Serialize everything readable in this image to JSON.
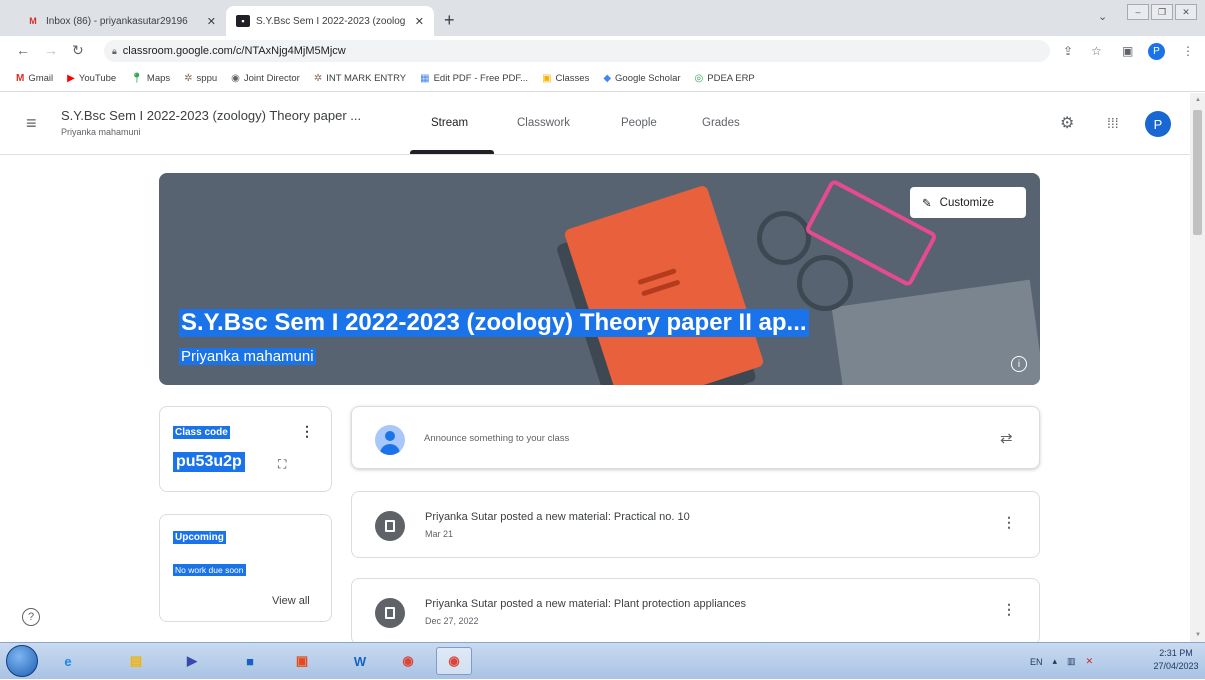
{
  "browser": {
    "tabs": [
      {
        "title": "Inbox (86) - priyankasutar29196",
        "favicon": "gmail-icon",
        "active": false
      },
      {
        "title": "S.Y.Bsc Sem I 2022-2023 (zoolog",
        "favicon": "classroom-icon",
        "active": true
      }
    ],
    "url": "classroom.google.com/c/NTAxNjg4MjM5Mjcw",
    "profile_initial": "P",
    "bookmarks": [
      {
        "label": "Gmail",
        "icon": "gmail-icon"
      },
      {
        "label": "YouTube",
        "icon": "youtube-icon"
      },
      {
        "label": "Maps",
        "icon": "maps-icon"
      },
      {
        "label": "sppu",
        "icon": "sppu-icon"
      },
      {
        "label": "Joint Director",
        "icon": "globe-icon"
      },
      {
        "label": "INT MARK ENTRY",
        "icon": "sppu-icon"
      },
      {
        "label": "Edit PDF - Free PDF...",
        "icon": "pdf-icon"
      },
      {
        "label": "Classes",
        "icon": "classroom-icon"
      },
      {
        "label": "Google Scholar",
        "icon": "scholar-icon"
      },
      {
        "label": "PDEA ERP",
        "icon": "erp-icon"
      }
    ]
  },
  "classroom": {
    "class_title": "S.Y.Bsc Sem I 2022-2023 (zoology) Theory paper ...",
    "class_teacher": "Priyanka mahamuni",
    "nav": [
      "Stream",
      "Classwork",
      "People",
      "Grades"
    ],
    "user_initial": "P",
    "banner": {
      "title": "S.Y.Bsc Sem I 2022-2023 (zoology) Theory paper II ap...",
      "teacher": "Priyanka mahamuni",
      "customize_label": "Customize"
    },
    "class_code": {
      "label": "Class code",
      "value": "pu53u2p"
    },
    "upcoming": {
      "label": "Upcoming",
      "empty_text": "No work due soon",
      "view_all": "View all"
    },
    "announce_placeholder": "Announce something to your class",
    "posts": [
      {
        "title": "Priyanka Sutar posted a new material: Practical no. 10",
        "date": "Mar 21"
      },
      {
        "title": "Priyanka Sutar posted a new material: Plant protection appliances",
        "date": "Dec 27, 2022"
      }
    ]
  },
  "taskbar": {
    "language": "EN",
    "time": "2:31 PM",
    "date": "27/04/2023"
  },
  "colors": {
    "accent_blue": "#1a73e8",
    "banner_bg": "#576370",
    "book_orange": "#e8603c",
    "glasses_pink": "#e64a8f"
  }
}
